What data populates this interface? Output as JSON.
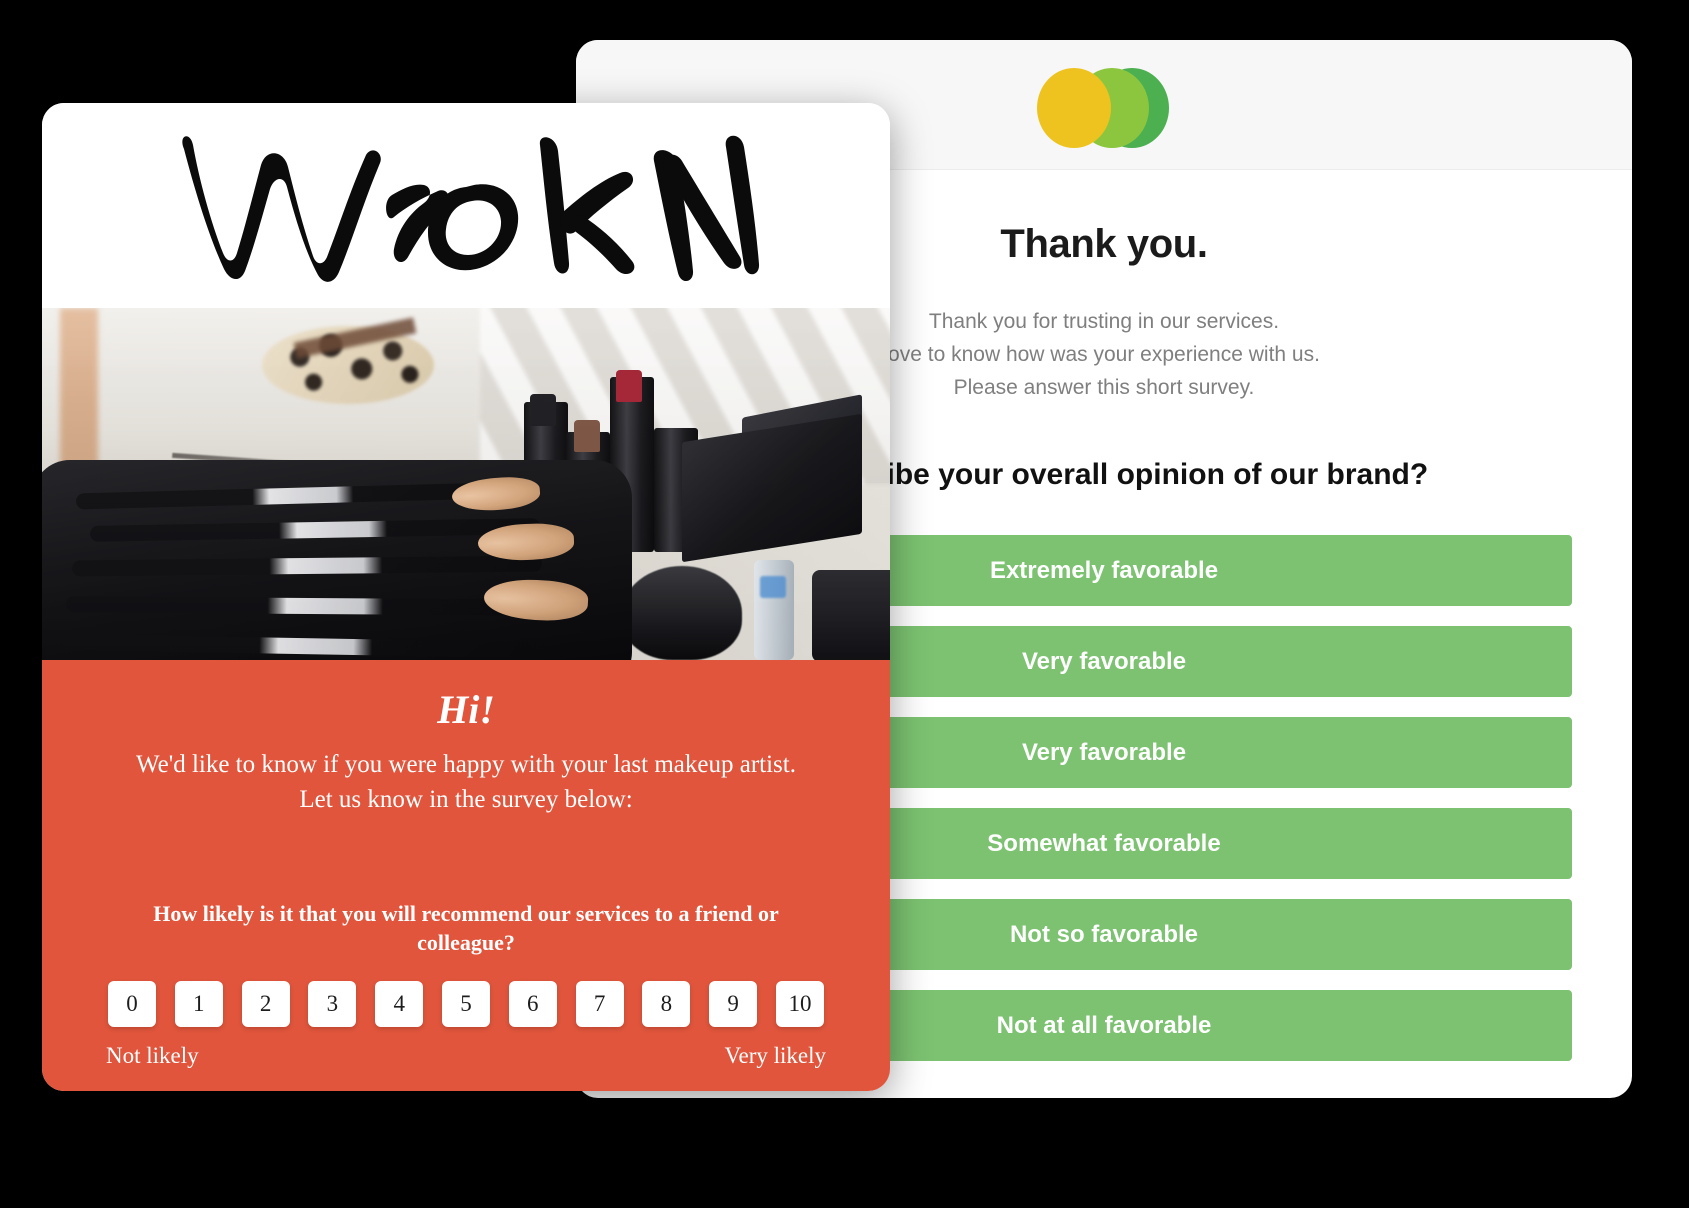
{
  "back_card": {
    "logo": {
      "name": "three-overlapping-circles-logo",
      "colors": [
        "#eec31f",
        "#8cc63f",
        "#4caf50"
      ]
    },
    "title": "Thank you.",
    "paragraph_lines": [
      "Thank you for trusting in our services.",
      "ove to know how was your experience with us.",
      "Please answer this short survey."
    ],
    "question": "u describe your overall opinion of our brand?",
    "answers": [
      "Extremely favorable",
      "Very favorable",
      "Very favorable",
      "Somewhat favorable",
      "Not so favorable",
      "Not at all favorable"
    ],
    "answer_color": "#7cc271"
  },
  "front_card": {
    "brand_logo_text": "WORN",
    "hero_photo_alt": "makeup-brushes-and-lipsticks-photo",
    "panel_color": "#e0553c",
    "greeting": "Hi!",
    "intro_lines": [
      "We'd like to know if you were happy with your last makeup artist.",
      "Let us know in the survey below:"
    ],
    "nps_question": "How likely is it that you will recommend our services to a friend or colleague?",
    "nps_scale": [
      "0",
      "1",
      "2",
      "3",
      "4",
      "5",
      "6",
      "7",
      "8",
      "9",
      "10"
    ],
    "scale_low_label": "Not likely",
    "scale_high_label": "Very likely"
  }
}
